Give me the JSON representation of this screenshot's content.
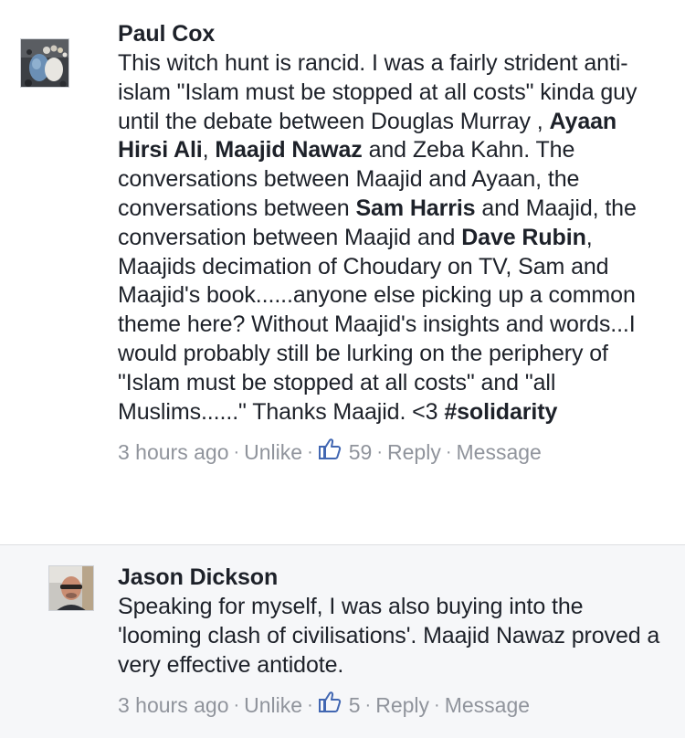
{
  "comments": [
    {
      "author": "Paul Cox",
      "body": [
        {
          "text": "This witch hunt is rancid. I was a fairly strident anti-islam \"Islam must be stopped at all costs\" kinda guy until the debate between Douglas Murray , ",
          "bold": false
        },
        {
          "text": "Ayaan Hirsi Ali",
          "bold": true
        },
        {
          "text": ", ",
          "bold": false
        },
        {
          "text": "Maajid Nawaz",
          "bold": true
        },
        {
          "text": " and Zeba Kahn. The conversations between Maajid and Ayaan, the conversations between ",
          "bold": false
        },
        {
          "text": "Sam Harris",
          "bold": true
        },
        {
          "text": " and Maajid, the conversation between Maajid and ",
          "bold": false
        },
        {
          "text": "Dave Rubin",
          "bold": true
        },
        {
          "text": ", Maajids decimation of Choudary on TV, Sam and Maajid's book......anyone else picking up a common theme here? Without Maajid's insights and words...I would probably still be lurking on the periphery of \"Islam must be stopped at all costs\" and \"all Muslims......\" Thanks Maajid. <3 ",
          "bold": false
        },
        {
          "text": "#solidarity",
          "bold": true
        }
      ],
      "time": "3 hours ago",
      "unlike_label": "Unlike",
      "like_count": "59",
      "reply_label": "Reply",
      "message_label": "Message",
      "avatar_icon": "pebbles-footprint-avatar"
    },
    {
      "author": "Jason Dickson",
      "body": [
        {
          "text": "Speaking for myself, I was also buying into the 'looming clash of civilisations'.  Maajid Nawaz proved a very effective antidote.",
          "bold": false
        }
      ],
      "time": "3 hours ago",
      "unlike_label": "Unlike",
      "like_count": "5",
      "reply_label": "Reply",
      "message_label": "Message",
      "avatar_icon": "person-photo-avatar"
    }
  ],
  "separator": "·",
  "colors": {
    "text": "#1d2129",
    "meta": "#90949c",
    "like_blue": "#4267b2",
    "reply_bg": "#f6f7f9"
  }
}
